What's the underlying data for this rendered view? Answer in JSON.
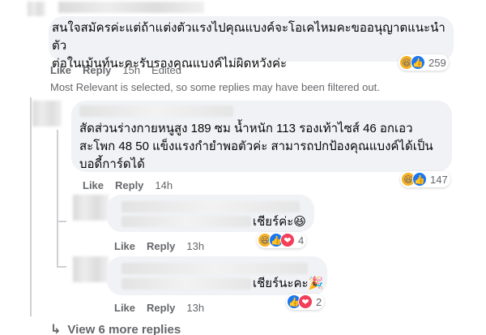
{
  "comments": [
    {
      "text_lines": [
        "สนใจสมัครค่ะแต่ถ้าแต่งตัวแรงไปคุณแบงค์จะโอเคไหมคะขออนุญาตแนะนำตัว",
        "ต่อในเม้นท์นะคะรับรองคุณแบงค์ไม่ผิดหวังค่ะ"
      ],
      "like": "Like",
      "reply": "Reply",
      "time": "15h",
      "edited": "Edited",
      "reaction_count": "259"
    },
    {
      "text_lines": [
        "สัดส่วนร่างกายหนูสูง 189 ซม น้ำหนัก 113 รองเท้าไซส์ 46 อกเอว",
        "สะโพก 48 50 แข็งแรงกำยำพอตัวค่ะ สามารถปกป้องคุณแบงค์ได้เป็น",
        "บอดี้การ์ดได้"
      ],
      "like": "Like",
      "reply": "Reply",
      "time": "14h",
      "reaction_count": "147"
    },
    {
      "text_suffix": "เชียร์ค่ะ😆",
      "like": "Like",
      "reply": "Reply",
      "time": "13h",
      "reaction_count": "4"
    },
    {
      "text_suffix": "เชียร์นะคะ🎉",
      "like": "Like",
      "reply": "Reply",
      "time": "13h",
      "reaction_count": "2"
    }
  ],
  "notice": "Most Relevant is selected, so some replies may have been filtered out.",
  "more_replies": "View 6 more replies",
  "icons": {
    "haha": "😆",
    "like": "👍",
    "love": "❤",
    "arrow": "↳"
  },
  "colors": {
    "bubble": "#f0f2f5",
    "meta": "#65676b",
    "like_blue": "#1877f2",
    "love_red": "#f33e58"
  }
}
